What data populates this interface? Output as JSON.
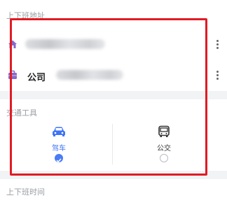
{
  "commute_address": {
    "section_title": "上下班地址",
    "home": {
      "icon": "home-icon",
      "address_blurred": true
    },
    "company": {
      "icon": "briefcase-icon",
      "label": "公司",
      "address_blurred": true
    }
  },
  "transport": {
    "section_title": "交通工具",
    "options": [
      {
        "icon": "car-icon",
        "label": "驾车",
        "selected": true,
        "color": "#3f74f5"
      },
      {
        "icon": "bus-icon",
        "label": "公交",
        "selected": false,
        "color": "#333333"
      }
    ]
  },
  "commute_time": {
    "section_title": "上下班时间"
  },
  "colors": {
    "accent": "#4a7cf6",
    "icon_purple": "#8a67c9",
    "highlight_frame": "#e01b24"
  }
}
